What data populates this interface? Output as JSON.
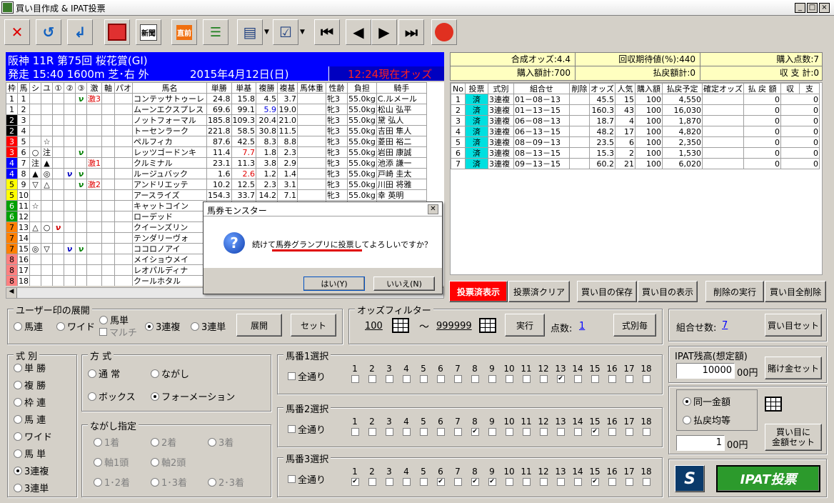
{
  "window": {
    "title": "買い目作成 & IPAT投票"
  },
  "toolbar": {
    "buttons": [
      "close-icon",
      "undo-icon",
      "return-icon",
      "record-icon",
      "newspaper-icon",
      "before-icon",
      "list-icon",
      "doc-icon",
      "check-icon",
      "first-icon",
      "prev-icon",
      "next-icon",
      "last-icon",
      "logo-icon"
    ],
    "news_label": "新聞",
    "before_label": "直前"
  },
  "race": {
    "header1": "阪神 11R 第75回 桜花賞(GI)",
    "header2": "発走 15:40 1600m 芝･右 外",
    "date": "2015年4月12日(日)",
    "odds_time": "12:24現在オッズ"
  },
  "horse_table": {
    "columns": [
      "枠",
      "馬",
      "シ",
      "ユ",
      "①",
      "②",
      "③",
      "激",
      "軸",
      "パオ",
      "馬名",
      "単勝",
      "単基",
      "複勝",
      "複基",
      "馬体重",
      "性齢",
      "負担",
      "騎手"
    ],
    "rows": [
      [
        "1",
        "1",
        "",
        "",
        "",
        "",
        "ν",
        "激3",
        "",
        "",
        "コンテッサトゥーレ",
        "24.8",
        "15.8",
        "4.5",
        "3.7",
        "",
        "牝3",
        "55.0kg",
        "C.ルメール"
      ],
      [
        "1",
        "2",
        "",
        "",
        "",
        "",
        "",
        "",
        "",
        "",
        "ムーンエクスプレス",
        "69.6",
        "99.1",
        "5.9",
        "19.0",
        "",
        "牝3",
        "55.0kg",
        "松山 弘平"
      ],
      [
        "2",
        "3",
        "",
        "",
        "",
        "",
        "",
        "",
        "",
        "",
        "ノットフォーマル",
        "185.8",
        "109.3",
        "20.4",
        "21.0",
        "",
        "牝3",
        "55.0kg",
        "黛 弘人"
      ],
      [
        "2",
        "4",
        "",
        "",
        "",
        "",
        "",
        "",
        "",
        "",
        "トーセンラーク",
        "221.8",
        "58.5",
        "30.8",
        "11.5",
        "",
        "牝3",
        "55.0kg",
        "吉田 隼人"
      ],
      [
        "3",
        "5",
        "",
        "☆",
        "",
        "",
        "",
        "",
        "",
        "",
        "ペルフィカ",
        "87.6",
        "42.5",
        "8.3",
        "8.8",
        "",
        "牝3",
        "55.0kg",
        "菱田 裕二"
      ],
      [
        "3",
        "6",
        "○",
        "注",
        "",
        "",
        "ν",
        "",
        "",
        "",
        "レッツゴードンキ",
        "11.4",
        "7.7",
        "1.8",
        "2.3",
        "",
        "牝3",
        "55.0kg",
        "岩田 康誠"
      ],
      [
        "4",
        "7",
        "注",
        "▲",
        "",
        "",
        "",
        "激1",
        "",
        "",
        "クルミナル",
        "23.1",
        "11.3",
        "3.8",
        "2.9",
        "",
        "牝3",
        "55.0kg",
        "池添 謙一"
      ],
      [
        "4",
        "8",
        "▲",
        "◎",
        "",
        "ν",
        "ν",
        "",
        "",
        "",
        "ルージュバック",
        "1.6",
        "2.6",
        "1.2",
        "1.4",
        "",
        "牝3",
        "55.0kg",
        "戸崎 圭太"
      ],
      [
        "5",
        "9",
        "▽",
        "△",
        "",
        "",
        "ν",
        "激2",
        "",
        "",
        "アンドリエッテ",
        "10.2",
        "12.5",
        "2.3",
        "3.1",
        "",
        "牝3",
        "55.0kg",
        "川田 将雅"
      ],
      [
        "5",
        "10",
        "",
        "",
        "",
        "",
        "",
        "",
        "",
        "",
        "アースライズ",
        "154.3",
        "33.7",
        "14.2",
        "7.1",
        "",
        "牝3",
        "55.0kg",
        "幸 英明"
      ],
      [
        "6",
        "11",
        "☆",
        "",
        "",
        "",
        "",
        "",
        "",
        "",
        "キャットコイン",
        "",
        "",
        "",
        "",
        "",
        "",
        "",
        ""
      ],
      [
        "6",
        "12",
        "",
        "",
        "",
        "",
        "",
        "",
        "",
        "",
        "ローデッド",
        "",
        "",
        "",
        "",
        "",
        "",
        "",
        ""
      ],
      [
        "7",
        "13",
        "△",
        "○",
        "ν",
        "",
        "",
        "",
        "",
        "",
        "クイーンズリン",
        "",
        "",
        "",
        "",
        "",
        "",
        "",
        ""
      ],
      [
        "7",
        "14",
        "",
        "",
        "",
        "",
        "",
        "",
        "",
        "",
        "テンダリーヴォ",
        "",
        "",
        "",
        "",
        "",
        "",
        "",
        ""
      ],
      [
        "7",
        "15",
        "◎",
        "▽",
        "",
        "ν",
        "ν",
        "",
        "",
        "",
        "ココロノアイ",
        "",
        "",
        "",
        "",
        "",
        "",
        "",
        ""
      ],
      [
        "8",
        "16",
        "",
        "",
        "",
        "",
        "",
        "",
        "",
        "",
        "メイショウメイ",
        "",
        "",
        "",
        "",
        "",
        "",
        "",
        ""
      ],
      [
        "8",
        "17",
        "",
        "",
        "",
        "",
        "",
        "",
        "",
        "",
        "レオパルディナ",
        "",
        "",
        "",
        "",
        "",
        "",
        "",
        ""
      ],
      [
        "8",
        "18",
        "",
        "",
        "",
        "",
        "",
        "",
        "",
        "",
        "クールホタル",
        "",
        "",
        "",
        "",
        "",
        "",
        "",
        ""
      ]
    ]
  },
  "summary": {
    "synth_odds": "合成オッズ:4.4",
    "expected": "回収期待値(%):440",
    "purchase_points": "購入点数:7",
    "purchase_total": "購入額計:700",
    "refund_total": "払戻額計:0",
    "balance": "収 支 計:0"
  },
  "bet_table": {
    "columns": [
      "No",
      "投票",
      "式別",
      "組合せ",
      "削除",
      "オッズ",
      "人気",
      "購入額",
      "払戻予定",
      "確定オッズ",
      "払 戻 額",
      "収",
      "支"
    ],
    "rows": [
      [
        "1",
        "済",
        "3連複",
        "01－08－13",
        "",
        "45.5",
        "15",
        "100",
        "4,550",
        "",
        "0",
        "0"
      ],
      [
        "2",
        "済",
        "3連複",
        "01－13－15",
        "",
        "160.3",
        "43",
        "100",
        "16,030",
        "",
        "0",
        "0"
      ],
      [
        "3",
        "済",
        "3連複",
        "06－08－13",
        "",
        "18.7",
        "4",
        "100",
        "1,870",
        "",
        "0",
        "0"
      ],
      [
        "4",
        "済",
        "3連複",
        "06－13－15",
        "",
        "48.2",
        "17",
        "100",
        "4,820",
        "",
        "0",
        "0"
      ],
      [
        "5",
        "済",
        "3連複",
        "08－09－13",
        "",
        "23.5",
        "6",
        "100",
        "2,350",
        "",
        "0",
        "0"
      ],
      [
        "6",
        "済",
        "3連複",
        "08－13－15",
        "",
        "15.3",
        "2",
        "100",
        "1,530",
        "",
        "0",
        "0"
      ],
      [
        "7",
        "済",
        "3連複",
        "09－13－15",
        "",
        "60.2",
        "21",
        "100",
        "6,020",
        "",
        "0",
        "0"
      ]
    ]
  },
  "action_buttons": {
    "shown": "投票済表示",
    "clear": "投票済クリア",
    "save": "買い目の保存",
    "show": "買い目の表示",
    "exec_delete": "削除の実行",
    "delete_all": "買い目全削除"
  },
  "user_mark": {
    "legend": "ユーザー印の展開",
    "opts": [
      "馬連",
      "ワイド",
      "馬単",
      "3連複",
      "3連単"
    ],
    "multi": "マルチ",
    "expand": "展開",
    "set": "セット"
  },
  "odds_filter": {
    "legend": "オッズフィルター",
    "min": "100",
    "tilde": "～",
    "max": "999999",
    "run": "実行",
    "points_label": "点数:",
    "points_value": "1",
    "by_type": "式別毎"
  },
  "combo": {
    "label": "組合せ数:",
    "value": "7",
    "set": "買い目セット"
  },
  "bet_type": {
    "legend": "式 別",
    "opts": [
      "単 勝",
      "複 勝",
      "枠 連",
      "馬 連",
      "ワイド",
      "馬 単",
      "3連複",
      "3連単"
    ]
  },
  "method": {
    "legend": "方 式",
    "opts": [
      "通 常",
      "ながし",
      "ボックス",
      "フォーメーション"
    ]
  },
  "nagashi": {
    "legend": "ながし指定",
    "opts": [
      "1着",
      "2着",
      "3着",
      "軸1頭",
      "軸2頭",
      "1･2着",
      "1･3着",
      "2･3着"
    ]
  },
  "selections": [
    {
      "legend": "馬番1選択",
      "all": "全通り",
      "checked": [
        13
      ]
    },
    {
      "legend": "馬番2選択",
      "all": "全通り",
      "checked": [
        8,
        15
      ]
    },
    {
      "legend": "馬番3選択",
      "all": "全通り",
      "checked": [
        1,
        6,
        8,
        9,
        15
      ]
    }
  ],
  "ipat": {
    "legend": "IPAT残高(想定額)",
    "balance": "10000",
    "yen": "00円",
    "bet_set": "賭け金セット",
    "same": "同一金額",
    "equal": "払戻均等",
    "amount": "1",
    "amount_yen": "00円",
    "amount_set_l1": "買い目に",
    "amount_set_l2": "金額セット",
    "s_label": "S",
    "vote": "IPAT投票"
  },
  "dialog": {
    "title": "馬券モンスター",
    "message": "続けて馬券グランプリに投票してよろしいですか？",
    "yes": "はい(Y)",
    "no": "いいえ(N)"
  },
  "colors": {
    "waku": [
      "#ffffff",
      "#000000",
      "#ff0000",
      "#0000ff",
      "#ffff00",
      "#00a000",
      "#ff8000",
      "#ff8080"
    ],
    "waku_text": [
      "#000",
      "#fff",
      "#fff",
      "#fff",
      "#000",
      "#fff",
      "#000",
      "#000"
    ]
  }
}
